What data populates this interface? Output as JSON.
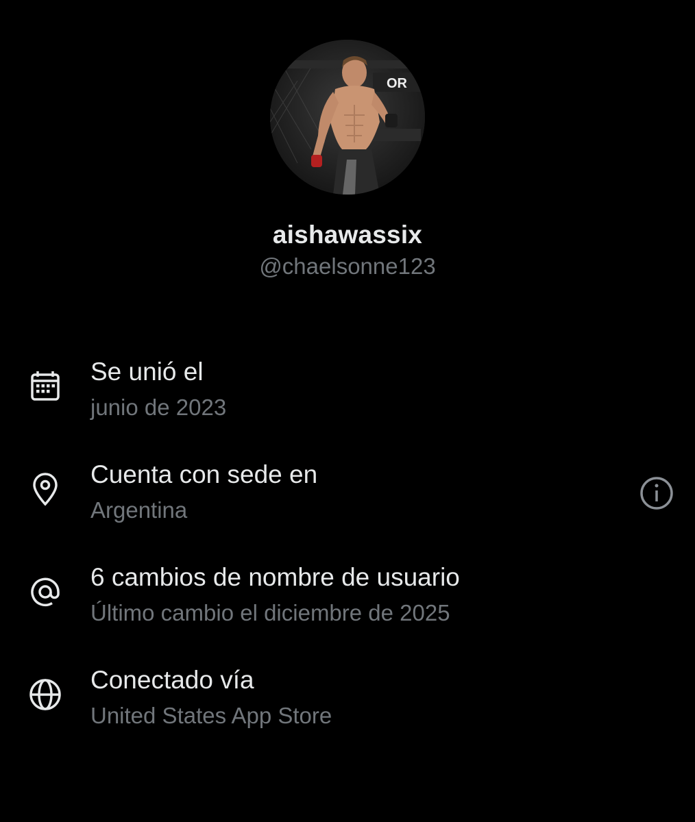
{
  "profile": {
    "display_name": "aishawassix",
    "handle": "@chaelsonne123",
    "avatar_icon": "profile-photo-fighter"
  },
  "details": [
    {
      "icon": "calendar-icon",
      "title": "Se unió el",
      "subtitle": "junio de 2023"
    },
    {
      "icon": "location-pin-icon",
      "title": "Cuenta con sede en",
      "subtitle": "Argentina",
      "action_icon": "info-icon"
    },
    {
      "icon": "at-sign-icon",
      "title": "6 cambios de nombre de usuario",
      "subtitle": "Último cambio el diciembre de 2025"
    },
    {
      "icon": "globe-icon",
      "title": "Conectado vía",
      "subtitle": "United States App Store"
    }
  ],
  "colors": {
    "background": "#000000",
    "primary_text": "#e7e9ea",
    "secondary_text": "#71767b"
  }
}
